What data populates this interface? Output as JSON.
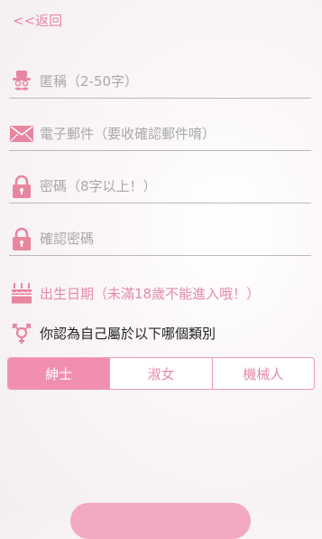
{
  "header": {
    "back_label": "<<返回"
  },
  "form": {
    "nickname_placeholder": "匿稱（2-50字）",
    "email_placeholder": "電子郵件（要收確認郵件唷）",
    "password_placeholder": "密碼（8字以上！）",
    "confirm_password_placeholder": "確認密碼",
    "birthday_label": "出生日期（未滿18歲不能進入哦！）",
    "gender_question": "你認為自己屬於以下哪個類別",
    "gender_options": [
      "紳士",
      "淑女",
      "機械人"
    ],
    "gender_selected": "紳士"
  },
  "colors": {
    "accent": "#f08fb0",
    "accent_text": "#e58aa9"
  }
}
